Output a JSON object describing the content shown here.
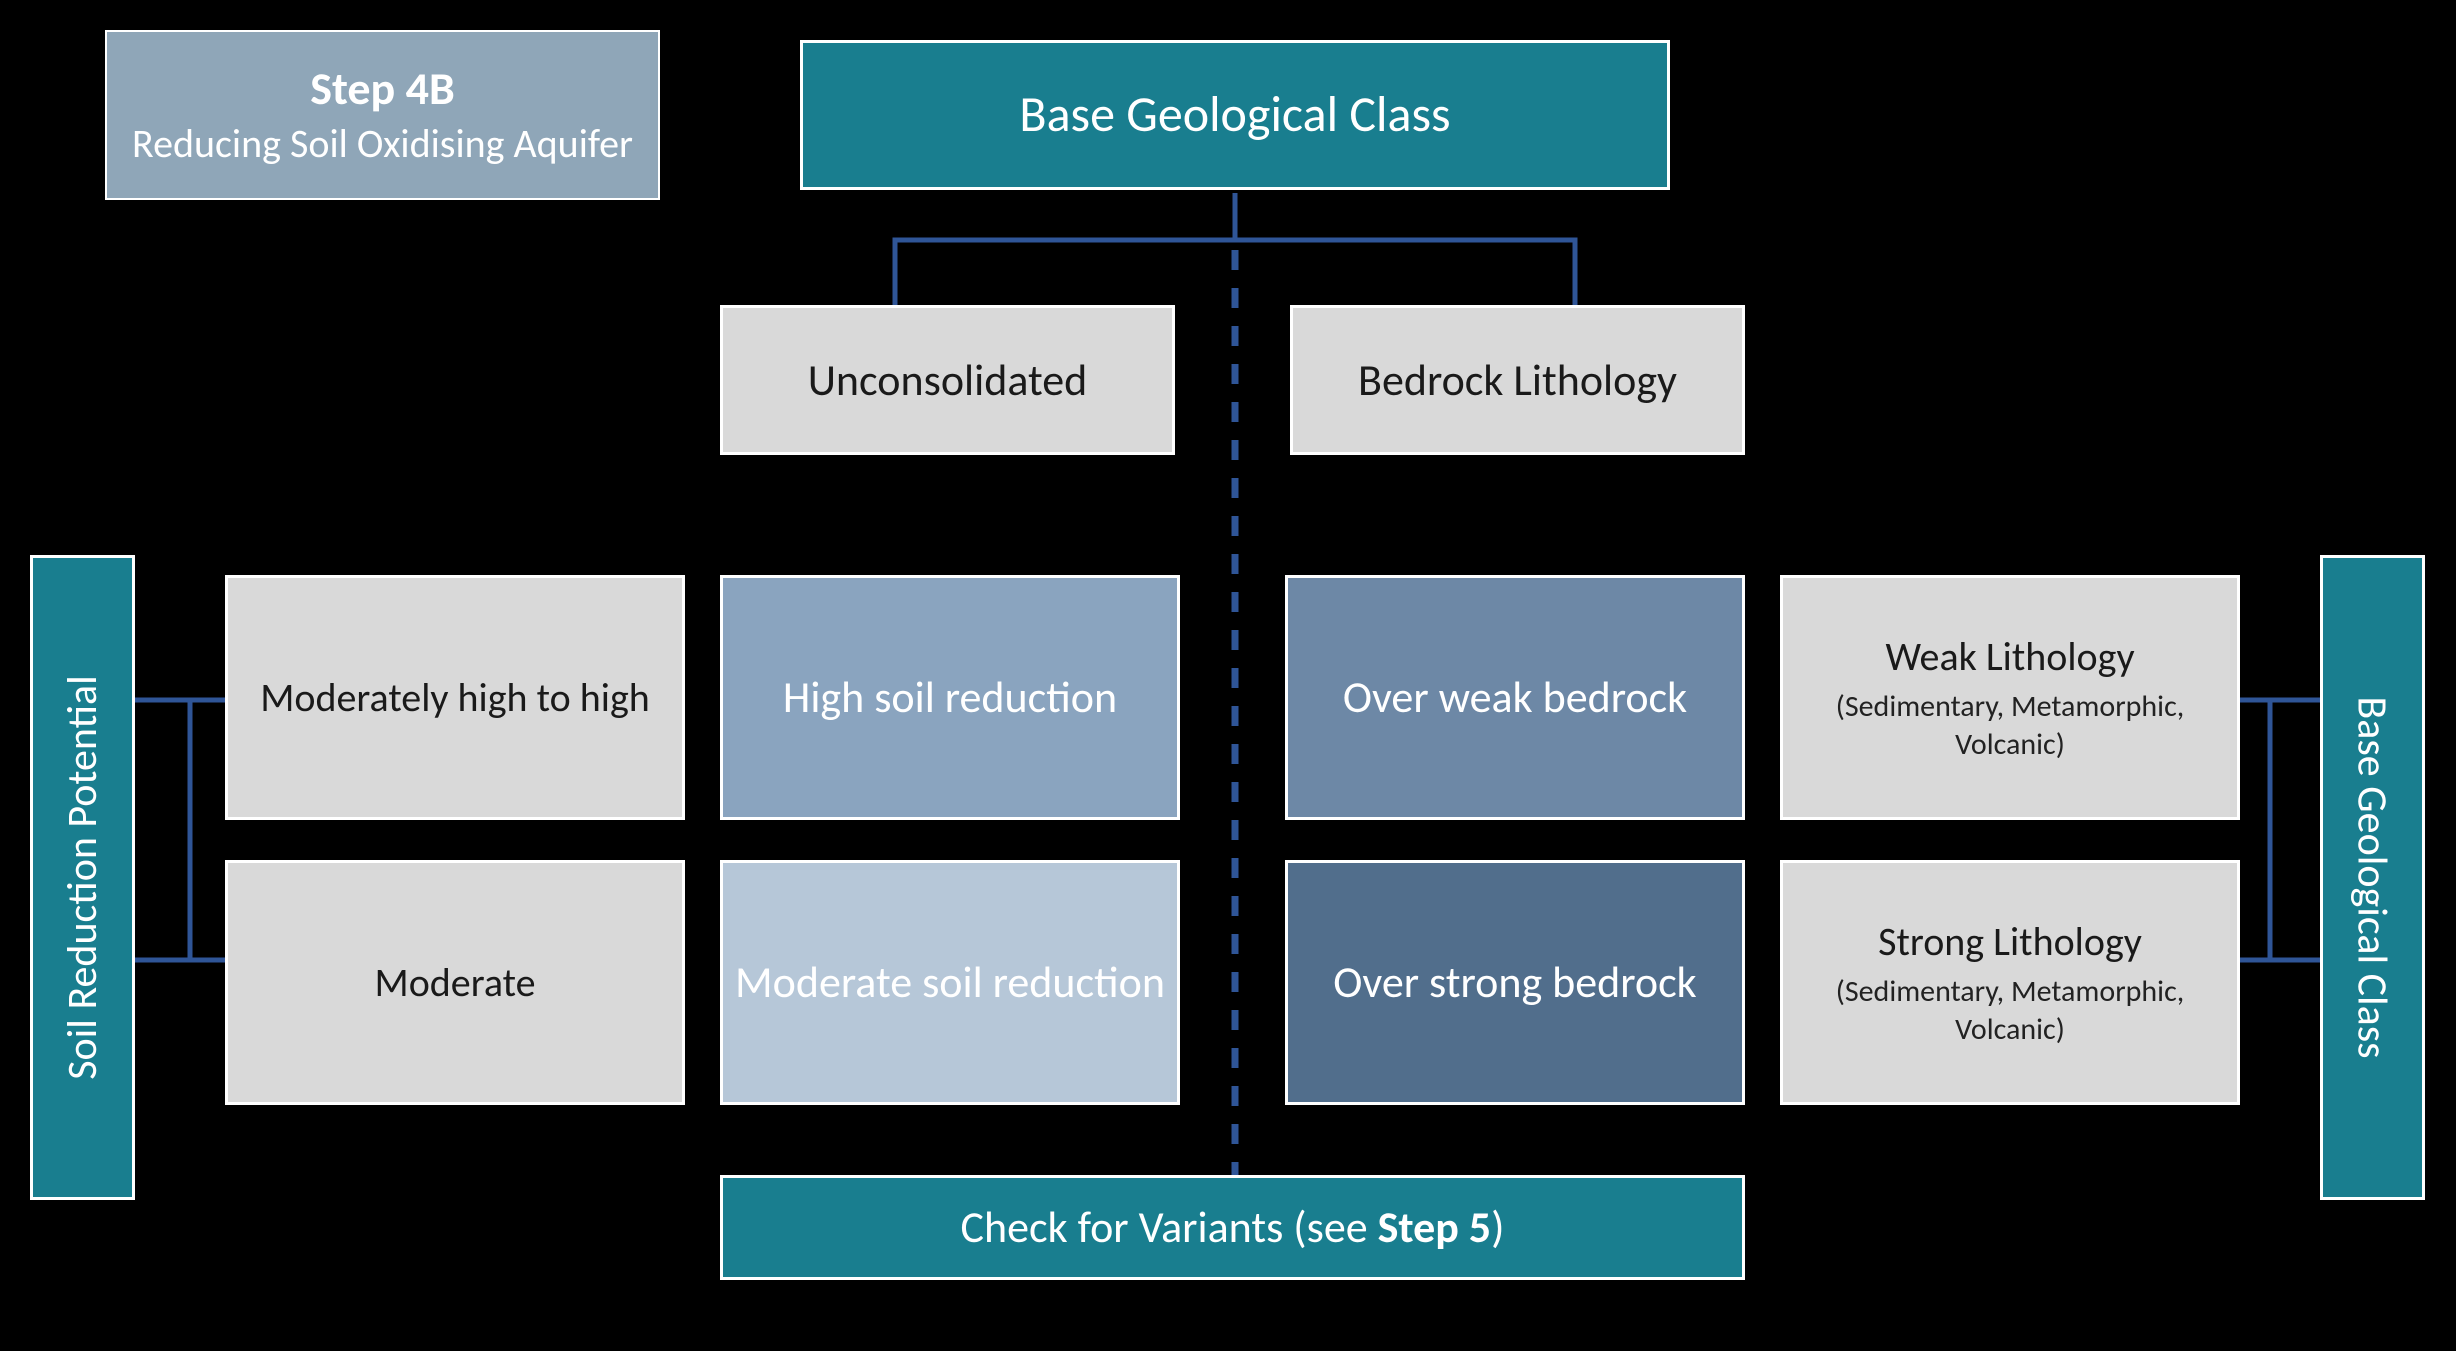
{
  "step_badge": {
    "title": "Step 4B",
    "subtitle": "Reducing Soil Oxidising Aquifer"
  },
  "top": {
    "root": "Base Geological Class",
    "left": "Unconsolidated",
    "right": "Bedrock Lithology"
  },
  "left_axis": "Soil Reduction Potential",
  "right_axis": "Base Geological Class",
  "rows": {
    "srp": {
      "top": "Moderately high to high",
      "bottom": "Moderate"
    },
    "unconsolidated": {
      "top": "High soil reduction",
      "bottom": "Moderate soil reduction"
    },
    "bedrock": {
      "top": "Over weak bedrock",
      "bottom": "Over strong bedrock"
    },
    "lithology": {
      "top": {
        "title": "Weak Lithology",
        "sub": "(Sedimentary, Metamorphic, Volcanic)"
      },
      "bottom": {
        "title": "Strong Lithology",
        "sub": "(Sedimentary, Metamorphic, Volcanic)"
      }
    }
  },
  "footer": {
    "pre": "Check for Variants (see ",
    "bold": "Step 5",
    "post": ")"
  }
}
